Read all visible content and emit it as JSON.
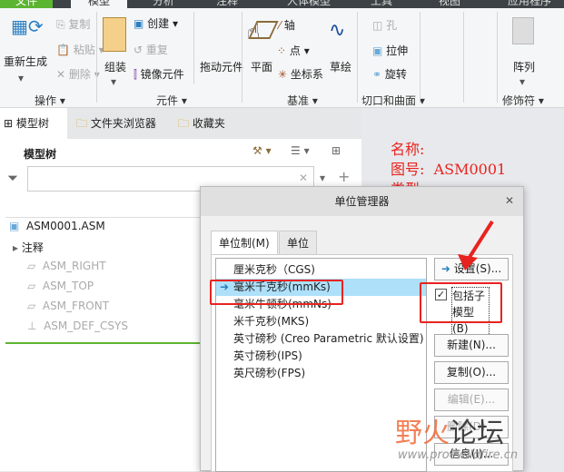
{
  "menu_tabs": [
    "文件",
    "模型",
    "分析",
    "注释",
    "人体模型",
    "工具",
    "视图",
    "应用程序"
  ],
  "ribbon": {
    "regenerate": "重新生成",
    "copy": "复制",
    "paste": "粘贴",
    "delete": "删除",
    "assemble": "组装",
    "create": "创建",
    "repeat": "重复",
    "mirror_component": "镜像元件",
    "drag_components": "拖动元件",
    "plane": "平面",
    "axis": "轴",
    "point": "点",
    "csys": "坐标系",
    "sketch": "草绘",
    "hole": "孔",
    "extrude": "拉伸",
    "revolve": "旋转",
    "pattern": "阵列",
    "groups": [
      "操作",
      "元件",
      "基准",
      "切口和曲面",
      "修饰符"
    ]
  },
  "left_panel": {
    "tabs": [
      "模型树",
      "文件夹浏览器",
      "收藏夹"
    ],
    "title": "模型树",
    "filter_value": "",
    "tree": [
      {
        "label": "ASM0001.ASM"
      },
      {
        "label": "注释"
      },
      {
        "label": "ASM_RIGHT"
      },
      {
        "label": "ASM_TOP"
      },
      {
        "label": "ASM_FRONT"
      },
      {
        "label": "ASM_DEF_CSYS"
      }
    ]
  },
  "drawing_text": [
    "名称:",
    "图号:  ASM0001",
    "类型:"
  ],
  "dialog": {
    "title": "单位管理器",
    "tabs": [
      "单位制(M)",
      "单位"
    ],
    "systems": [
      "厘米克秒（CGS)",
      "毫米千克秒(mmKs)",
      "毫米牛顿秒(mmNs)",
      "米千克秒(MKS)",
      "英寸磅秒 (Creo Parametric 默认设置)",
      "英寸磅秒(IPS)",
      "英尺磅秒(FPS)"
    ],
    "selected_index": 1,
    "set_button": "设置(S)...",
    "include_submodels": "包括子模型(B)",
    "include_checked": true,
    "new_button": "新建(N)...",
    "copy_button": "复制(O)...",
    "edit_button": "编辑(E)...",
    "delete_button": "删除(D)...",
    "info_button": "信息(I)..."
  },
  "watermark": {
    "text": "野火论坛",
    "url": "www.proewildfire.cn"
  },
  "colors": {
    "accent": "#9ad6f5",
    "highlight": "#e8231f",
    "green": "#5cb531"
  }
}
